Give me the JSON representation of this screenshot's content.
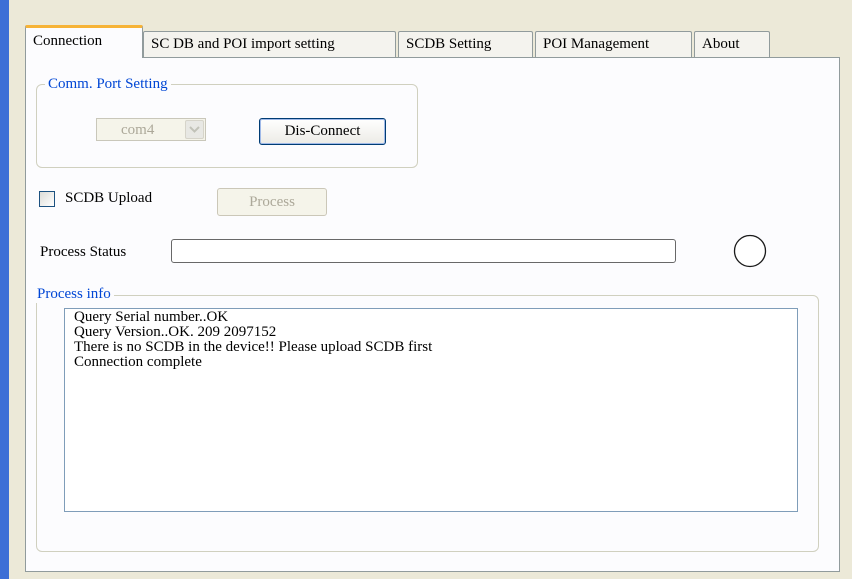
{
  "tabs": [
    {
      "label": "Connection",
      "active": true
    },
    {
      "label": "SC DB and POI import setting",
      "active": false
    },
    {
      "label": "SCDB  Setting",
      "active": false
    },
    {
      "label": "POI Management",
      "active": false
    },
    {
      "label": "About",
      "active": false
    }
  ],
  "comm_port": {
    "group_title": "Comm. Port Setting",
    "port_value": "com4",
    "disconnect_label": "Dis-Connect"
  },
  "upload": {
    "checkbox_label": "SCDB Upload",
    "checked": false,
    "process_label": "Process"
  },
  "status": {
    "label": "Process Status",
    "progress": 0
  },
  "info": {
    "group_title": "Process info",
    "lines": [
      "Query Serial number..OK",
      "Query Version..OK.  209     2097152",
      "There is no SCDB in the device!! Please upload SCDB first",
      "Connection complete"
    ]
  },
  "colors": {
    "accent_tab": "#f6b337",
    "group_title": "#0046d5",
    "window_edge": "#3d6fd6"
  }
}
